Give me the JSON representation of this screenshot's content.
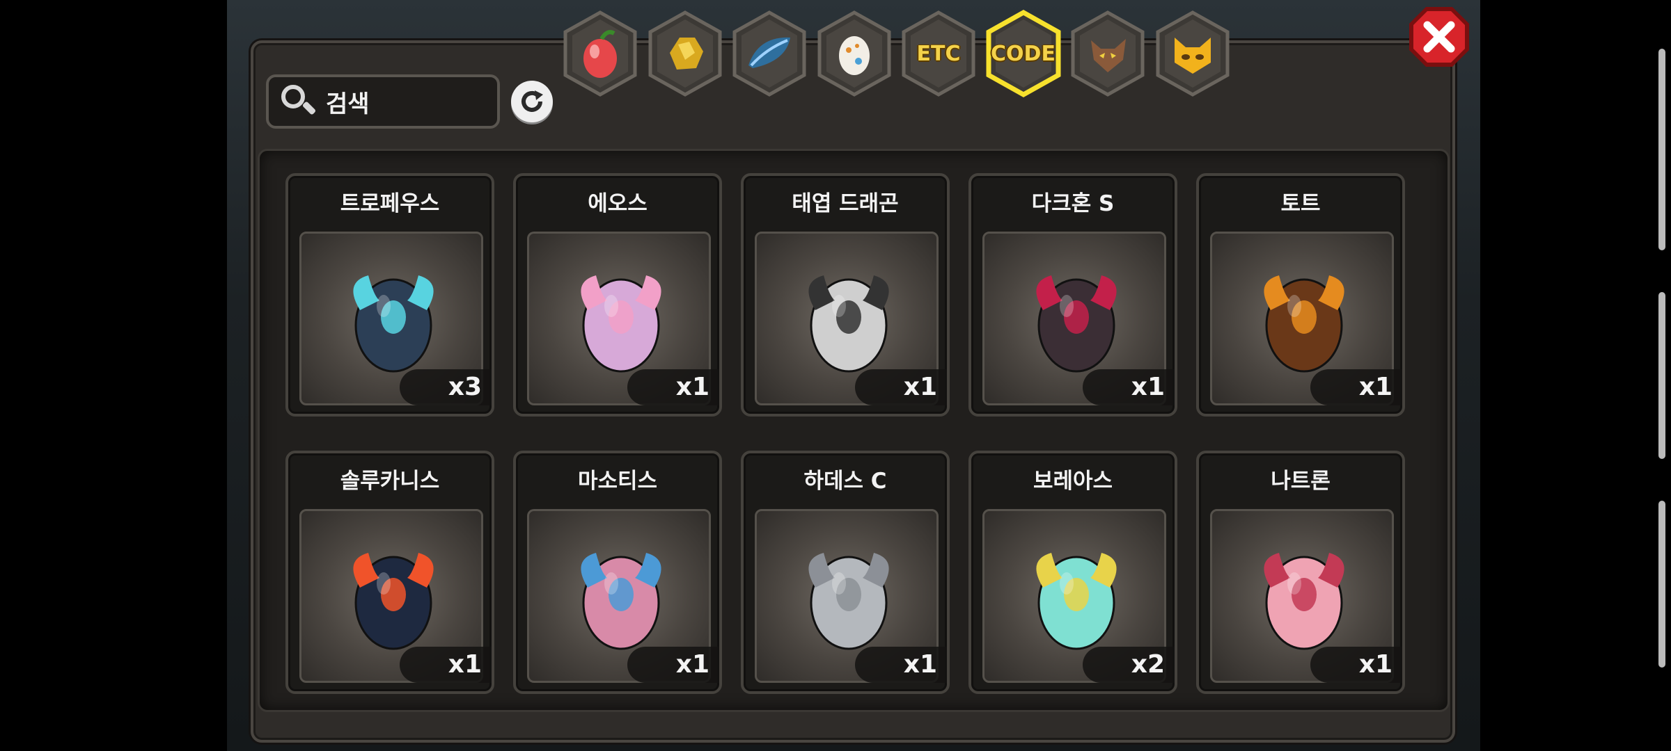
{
  "search": {
    "placeholder": "검색"
  },
  "tabs": [
    {
      "name": "fruit",
      "label": "",
      "icon": "fruit-tab-icon",
      "selected": false
    },
    {
      "name": "gold",
      "label": "",
      "icon": "gold-ore-tab-icon",
      "selected": false
    },
    {
      "name": "feather",
      "label": "",
      "icon": "blue-feather-tab-icon",
      "selected": false
    },
    {
      "name": "egg",
      "label": "",
      "icon": "egg-tab-icon",
      "selected": false
    },
    {
      "name": "etc",
      "label": "ETC",
      "icon": "",
      "selected": false
    },
    {
      "name": "code",
      "label": "CODE",
      "icon": "",
      "selected": true
    },
    {
      "name": "beast",
      "label": "",
      "icon": "wolf-tab-icon",
      "selected": false
    },
    {
      "name": "cat",
      "label": "",
      "icon": "cat-tab-icon",
      "selected": false
    }
  ],
  "items": [
    {
      "name": "트로페우스",
      "qty": "x3",
      "color": "#2c3f56",
      "accent": "#58d3e0"
    },
    {
      "name": "에오스",
      "qty": "x1",
      "color": "#d7a9d8",
      "accent": "#f2a0c8"
    },
    {
      "name": "태엽 드래곤",
      "qty": "x1",
      "color": "#cfcfcf",
      "accent": "#333333"
    },
    {
      "name": "다크혼 S",
      "qty": "x1",
      "color": "#3b2e35",
      "accent": "#c3204a"
    },
    {
      "name": "토트",
      "qty": "x1",
      "color": "#6a3818",
      "accent": "#e58b1f"
    },
    {
      "name": "솔루카니스",
      "qty": "x1",
      "color": "#1e2940",
      "accent": "#f0532a"
    },
    {
      "name": "마소티스",
      "qty": "x1",
      "color": "#d88aa8",
      "accent": "#4c9ad6"
    },
    {
      "name": "하데스 C",
      "qty": "x1",
      "color": "#b4b8bd",
      "accent": "#8c9097"
    },
    {
      "name": "보레아스",
      "qty": "x2",
      "color": "#7fe0d2",
      "accent": "#e8d34a"
    },
    {
      "name": "나트론",
      "qty": "x1",
      "color": "#efa3b3",
      "accent": "#c33a55"
    }
  ]
}
